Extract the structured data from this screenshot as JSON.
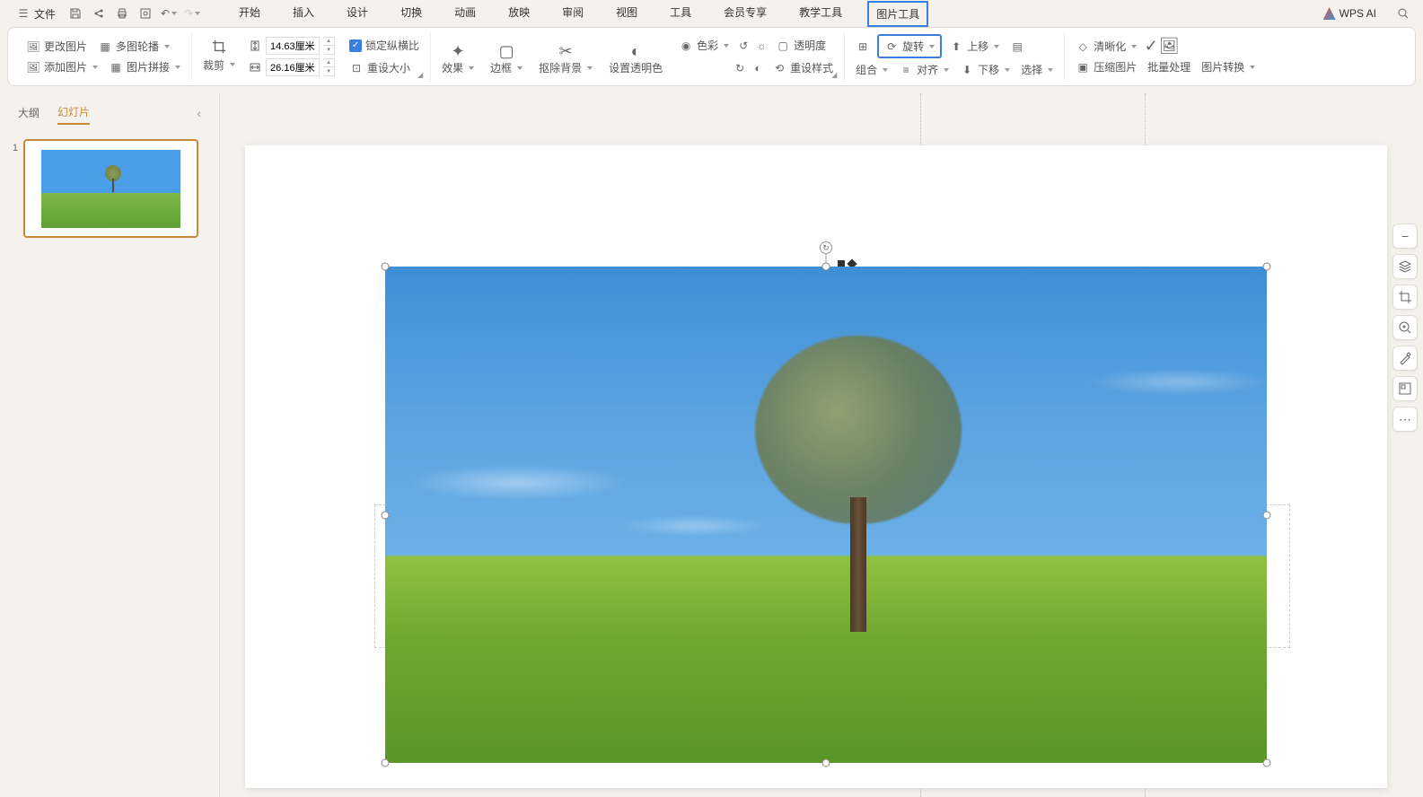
{
  "menubar": {
    "file": "文件",
    "tabs": [
      "开始",
      "插入",
      "设计",
      "切换",
      "动画",
      "放映",
      "审阅",
      "视图",
      "工具",
      "会员专享",
      "教学工具",
      "图片工具"
    ],
    "active_tab": "图片工具",
    "wps_ai": "WPS AI"
  },
  "ribbon": {
    "change_img": "更改图片",
    "multi_outline": "多图轮播",
    "add_img": "添加图片",
    "img_stitch": "图片拼接",
    "crop": "裁剪",
    "height": "14.63厘米",
    "width": "26.16厘米",
    "lock_ratio": "锁定纵横比",
    "reset_size": "重设大小",
    "effect": "效果",
    "border": "边框",
    "remove_bg": "抠除背景",
    "set_transparent": "设置透明色",
    "tint": "色彩",
    "transparency": "透明度",
    "reset_style": "重设样式",
    "group": "组合",
    "rotate": "旋转",
    "align": "对齐",
    "move_up": "上移",
    "move_down": "下移",
    "select": "选择",
    "sharpen": "清晰化",
    "compress": "压缩图片",
    "batch": "批量处理",
    "convert": "图片转换"
  },
  "sidebar": {
    "tab_outline": "大纲",
    "tab_slides": "幻灯片",
    "slide_num": "1"
  }
}
